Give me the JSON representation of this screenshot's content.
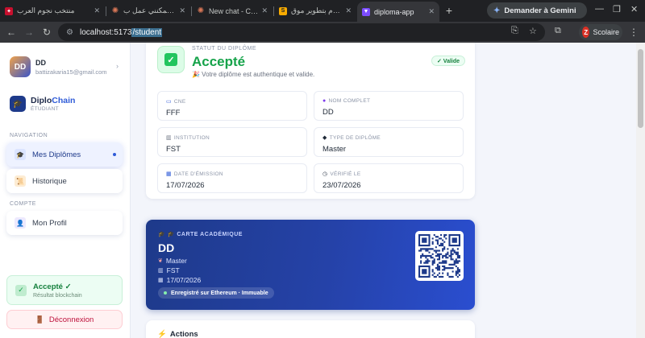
{
  "browser": {
    "tabs": [
      {
        "title": "منتخب نجوم العرب",
        "favicon": "flag",
        "active": false
      },
      {
        "title": "ماذا يمكنني عمل ب",
        "favicon": "claude",
        "active": false
      },
      {
        "title": "New chat - Claude",
        "favicon": "claude",
        "active": false
      },
      {
        "title": "سأقوم بتطوير موق",
        "favicon": "s-doc",
        "active": false
      },
      {
        "title": "diploma-app",
        "favicon": "vite",
        "active": true
      }
    ],
    "new_tab": "+",
    "gemini_label": "Demander à Gemini",
    "url_host": "localhost:5173",
    "url_path": "/student",
    "profile_initial": "Z",
    "profile_name": "Scolaire"
  },
  "sidebar": {
    "user_initials": "DD",
    "user_name": "DD",
    "user_email": "battizakaria15@gmail.com",
    "brand_diplo": "Diplo",
    "brand_chain": "Chain",
    "brand_role": "ÉTUDIANT",
    "nav_section": "NAVIGATION",
    "nav_items": [
      {
        "label": "Mes Diplômes",
        "icon": "graduation-cap-icon",
        "active": true
      },
      {
        "label": "Historique",
        "icon": "scroll-icon",
        "active": false
      }
    ],
    "account_section": "COMPTE",
    "profile_label": "Mon Profil",
    "status_title": "Accepté ✓",
    "status_sub": "Résultat blockchain",
    "logout_label": "Déconnexion"
  },
  "status_card": {
    "label": "STATUT DU DIPLÔME",
    "title": "Accepté",
    "desc": "🎉 Votre diplôme est authentique et valide.",
    "badge": "✓ Valide",
    "fields": [
      {
        "label": "CNE",
        "value": "FFF",
        "icon": "id-card-icon"
      },
      {
        "label": "NOM COMPLET",
        "value": "DD",
        "icon": "person-icon"
      },
      {
        "label": "INSTITUTION",
        "value": "FST",
        "icon": "building-icon"
      },
      {
        "label": "TYPE DE DIPLÔME",
        "value": "Master",
        "icon": "graduation-cap-icon"
      },
      {
        "label": "DATE D'ÉMISSION",
        "value": "17/07/2026",
        "icon": "calendar-icon"
      },
      {
        "label": "VÉRIFIÉ LE",
        "value": "23/07/2026",
        "icon": "clock-icon"
      }
    ]
  },
  "academic_card": {
    "label": "CARTE ACADÉMIQUE",
    "name": "DD",
    "degree": "Master",
    "institution": "FST",
    "date": "17/07/2026",
    "chain_badge": "Enregistré sur Ethereum · Immuable"
  },
  "actions": {
    "title": "Actions"
  },
  "colors": {
    "accent": "#2f5bd8",
    "success": "#16a34a",
    "danger": "#be123c",
    "card_blue": "#1e3a8a"
  }
}
